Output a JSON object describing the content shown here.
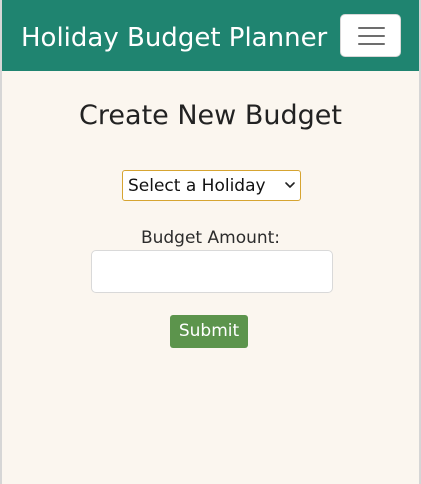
{
  "navbar": {
    "brand": "Holiday Budget Planner",
    "menu_icon": "hamburger-icon"
  },
  "main": {
    "title": "Create New Budget",
    "holiday_select": {
      "selected": "Select a Holiday",
      "icon": "chevron-down-icon"
    },
    "budget_amount": {
      "label": "Budget Amount:",
      "value": "",
      "placeholder": ""
    },
    "submit_label": "Submit"
  },
  "colors": {
    "navbar": "#1f8470",
    "background": "#fbf6ef",
    "select_border": "#d6a431",
    "submit": "#5c944c"
  }
}
